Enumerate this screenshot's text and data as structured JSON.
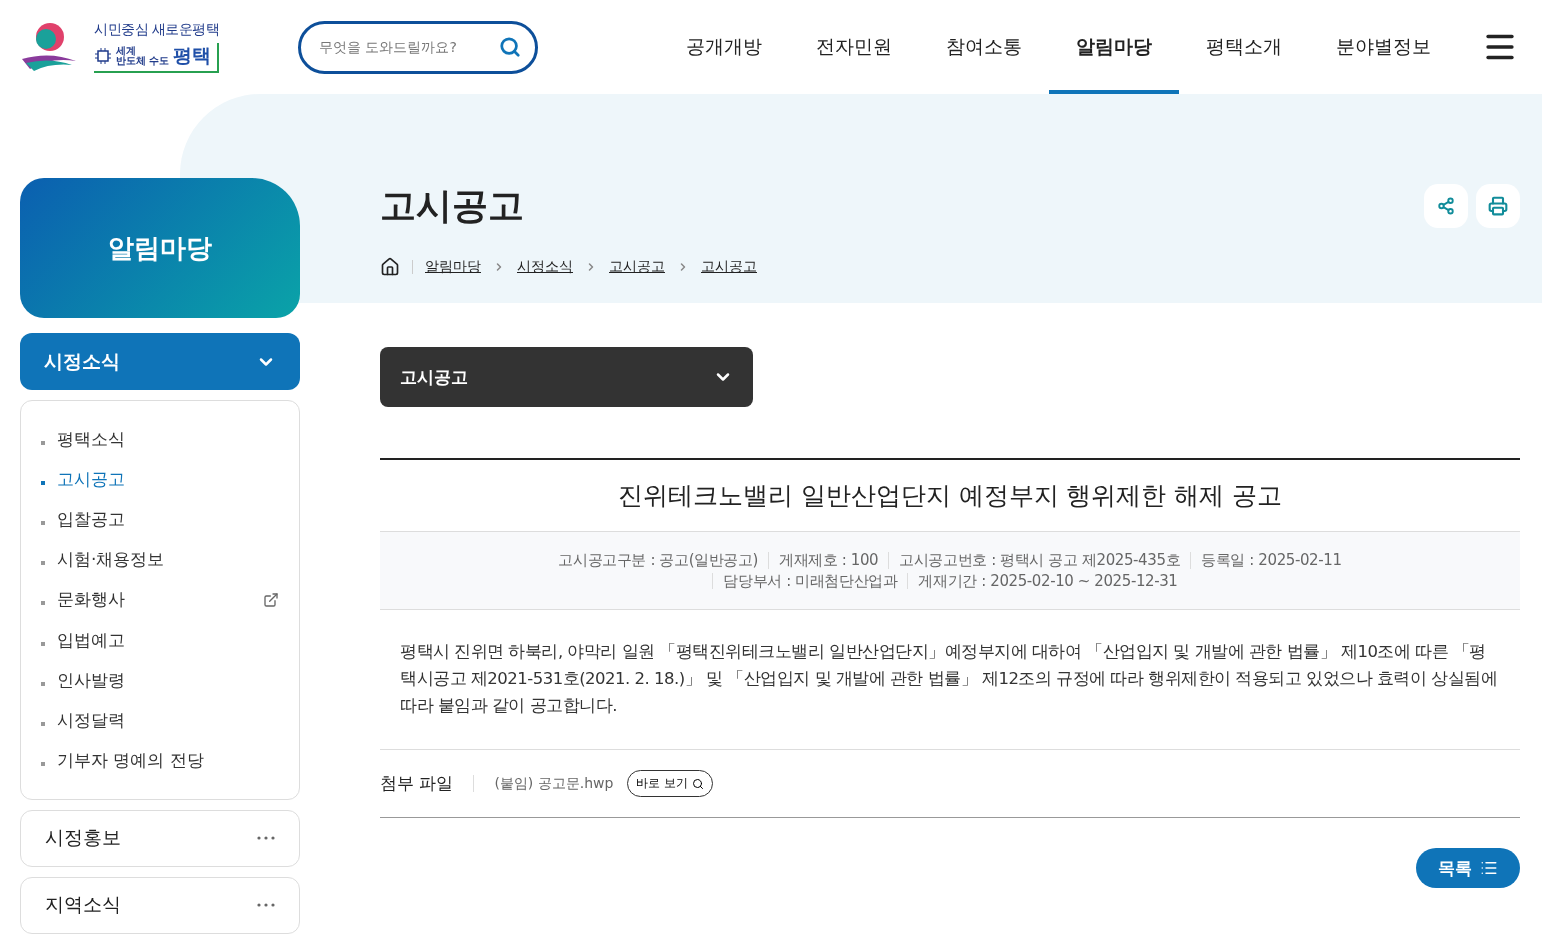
{
  "logo": {
    "slogan": "시민중심 새로운평택",
    "badge_small": "세계",
    "badge_sub": "반도체 수도",
    "badge_city": "평택"
  },
  "search": {
    "placeholder": "무엇을 도와드릴까요?"
  },
  "nav": [
    {
      "label": "공개개방",
      "selected": false
    },
    {
      "label": "전자민원",
      "selected": false
    },
    {
      "label": "참여소통",
      "selected": false
    },
    {
      "label": "알림마당",
      "selected": true
    },
    {
      "label": "평택소개",
      "selected": false
    },
    {
      "label": "분야별정보",
      "selected": false
    }
  ],
  "sidebar": {
    "title": "알림마당",
    "menus": [
      {
        "label": "시정소식",
        "expanded": true,
        "children": [
          {
            "label": "평택소식",
            "selected": false,
            "external": false
          },
          {
            "label": "고시공고",
            "selected": true,
            "external": false
          },
          {
            "label": "입찰공고",
            "selected": false,
            "external": false
          },
          {
            "label": "시험·채용정보",
            "selected": false,
            "external": false
          },
          {
            "label": "문화행사",
            "selected": false,
            "external": true
          },
          {
            "label": "입법예고",
            "selected": false,
            "external": false
          },
          {
            "label": "인사발령",
            "selected": false,
            "external": false
          },
          {
            "label": "시정달력",
            "selected": false,
            "external": false
          },
          {
            "label": "기부자 명예의 전당",
            "selected": false,
            "external": false
          }
        ]
      },
      {
        "label": "시정홍보",
        "expanded": false
      },
      {
        "label": "지역소식",
        "expanded": false
      }
    ]
  },
  "page_title": "고시공고",
  "breadcrumb": [
    "알림마당",
    "시정소식",
    "고시공고",
    "고시공고"
  ],
  "category_select": {
    "value": "고시공고"
  },
  "article": {
    "title": "진위테크노밸리 일반산업단지 예정부지 행위제한 해제 공고",
    "meta": [
      "고시공고구분 : 공고(일반공고)",
      "게재제호 : 100",
      "고시공고번호 : 평택시 공고 제2025-435호",
      "등록일 : 2025-02-11",
      "담당부서 : 미래첨단산업과",
      "게재기간 : 2025-02-10 ~ 2025-12-31"
    ],
    "body": "평택시 진위면 하북리, 야막리 일원 「평택진위테크노밸리 일반산업단지」예정부지에 대하여 「산업입지 및 개발에 관한 법률」 제10조에 따른 「평택시공고 제2021-531호(2021. 2. 18.)」 및 「산업입지 및 개발에 관한 법률」 제12조의 규정에 따라 행위제한이 적용되고 있었으나 효력이 상실됨에 따라 붙임과 같이 공고합니다.",
    "attachment_label": "첨부 파일",
    "attachment_file": "(붙임) 공고문.hwp",
    "preview_button": "바로 보기"
  },
  "list_button": "목록"
}
